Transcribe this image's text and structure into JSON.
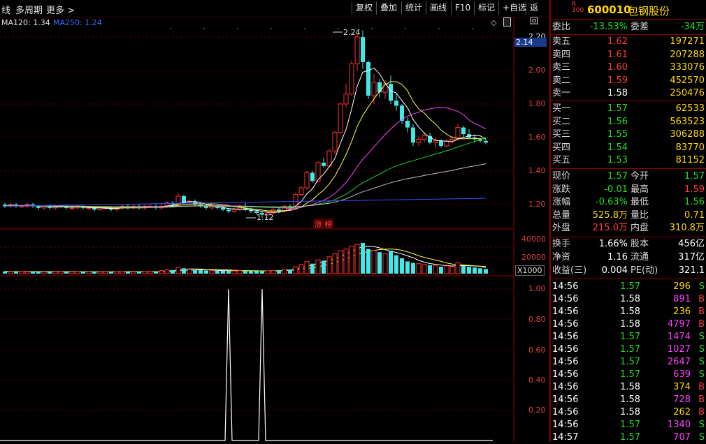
{
  "toolbar": {
    "left_items": [
      "线",
      "多周期",
      "更多 >"
    ],
    "buttons": [
      "复权",
      "叠加",
      "统计",
      "画线",
      "F10",
      "标记",
      "+自选",
      "返回"
    ]
  },
  "chart_header": {
    "ma120": "MA120: 1.34",
    "ma250": "MA250: 1.24"
  },
  "price_axis": {
    "ticks": [
      "2.20",
      "2.00",
      "1.80",
      "1.60",
      "1.40",
      "1.20"
    ],
    "current_label": "2.14",
    "high_annotation": "2.24",
    "low_annotation": "1.12",
    "badge": "涨 榜"
  },
  "volume_axis": {
    "ticks": [
      "40000",
      "20000"
    ],
    "multiplier": "X1000"
  },
  "indicator_axis": {
    "ticks": [
      "1.00",
      "0.80",
      "0.60",
      "0.40",
      "0.20"
    ]
  },
  "stock": {
    "badge_top": "R",
    "badge_bottom": "300",
    "code": "600010",
    "name": "包钢股份"
  },
  "order_book": {
    "ratio_label": "委比",
    "ratio_value": "-13.53%",
    "diff_label": "委差",
    "diff_value": "-34万",
    "asks": [
      {
        "label": "卖五",
        "price": "1.62",
        "volume": "197271"
      },
      {
        "label": "卖四",
        "price": "1.61",
        "volume": "207288"
      },
      {
        "label": "卖三",
        "price": "1.60",
        "volume": "333076"
      },
      {
        "label": "卖二",
        "price": "1.59",
        "volume": "452570"
      },
      {
        "label": "卖一",
        "price": "1.58",
        "volume": "250476"
      }
    ],
    "bids": [
      {
        "label": "买一",
        "price": "1.57",
        "volume": "62533"
      },
      {
        "label": "买二",
        "price": "1.56",
        "volume": "563523"
      },
      {
        "label": "买三",
        "price": "1.55",
        "volume": "306288"
      },
      {
        "label": "买四",
        "price": "1.54",
        "volume": "83770"
      },
      {
        "label": "买五",
        "price": "1.53",
        "volume": "81152"
      }
    ]
  },
  "quote": [
    {
      "l1": "现价",
      "v1": "1.57",
      "c1": "green",
      "l2": "今开",
      "v2": "1.57",
      "c2": "green"
    },
    {
      "l1": "涨跌",
      "v1": "-0.01",
      "c1": "green",
      "l2": "最高",
      "v2": "1.59",
      "c2": "red"
    },
    {
      "l1": "涨幅",
      "v1": "-0.63%",
      "c1": "green",
      "l2": "最低",
      "v2": "1.56",
      "c2": "green"
    },
    {
      "l1": "总量",
      "v1": "525.8万",
      "c1": "yellow",
      "l2": "量比",
      "v2": "0.71",
      "c2": "yellow"
    },
    {
      "l1": "外盘",
      "v1": "215.0万",
      "c1": "red",
      "l2": "内盘",
      "v2": "310.8万",
      "c2": "yellow"
    }
  ],
  "stats": [
    {
      "l1": "换手",
      "v1": "1.66%",
      "l2": "股本",
      "v2": "456亿"
    },
    {
      "l1": "净资",
      "v1": "1.16",
      "l2": "流通",
      "v2": "317亿"
    },
    {
      "l1": "收益(三)",
      "v1": "0.004",
      "l2": "PE(动)",
      "v2": "321.1"
    }
  ],
  "trades": [
    {
      "time": "14:56",
      "price": "1.57",
      "vol": "296",
      "side": "S"
    },
    {
      "time": "14:56",
      "price": "1.58",
      "vol": "891",
      "side": "B"
    },
    {
      "time": "14:56",
      "price": "1.58",
      "vol": "236",
      "side": "B"
    },
    {
      "time": "14:56",
      "price": "1.58",
      "vol": "4797",
      "side": "B"
    },
    {
      "time": "14:56",
      "price": "1.57",
      "vol": "1474",
      "side": "S"
    },
    {
      "time": "14:56",
      "price": "1.57",
      "vol": "1027",
      "side": "S"
    },
    {
      "time": "14:56",
      "price": "1.57",
      "vol": "2647",
      "side": "S"
    },
    {
      "time": "14:56",
      "price": "1.57",
      "vol": "639",
      "side": "S"
    },
    {
      "time": "14:56",
      "price": "1.58",
      "vol": "374",
      "side": "B"
    },
    {
      "time": "14:56",
      "price": "1.58",
      "vol": "728",
      "side": "B"
    },
    {
      "time": "14:56",
      "price": "1.58",
      "vol": "262",
      "side": "B"
    },
    {
      "time": "14:56",
      "price": "1.57",
      "vol": "1340",
      "side": "S"
    },
    {
      "time": "14:57",
      "price": "1.57",
      "vol": "707",
      "side": "S"
    }
  ],
  "chart_data": {
    "type": "bar",
    "candles": [
      [
        1.2,
        1.19,
        1.21,
        1.18
      ],
      [
        1.19,
        1.2,
        1.21,
        1.18
      ],
      [
        1.2,
        1.19,
        1.21,
        1.18
      ],
      [
        1.19,
        1.19,
        1.2,
        1.18
      ],
      [
        1.19,
        1.2,
        1.21,
        1.18
      ],
      [
        1.2,
        1.19,
        1.21,
        1.18
      ],
      [
        1.19,
        1.18,
        1.2,
        1.17
      ],
      [
        1.18,
        1.19,
        1.2,
        1.17
      ],
      [
        1.19,
        1.18,
        1.2,
        1.17
      ],
      [
        1.18,
        1.19,
        1.2,
        1.17
      ],
      [
        1.19,
        1.19,
        1.2,
        1.18
      ],
      [
        1.19,
        1.18,
        1.2,
        1.17
      ],
      [
        1.18,
        1.18,
        1.19,
        1.17
      ],
      [
        1.18,
        1.19,
        1.2,
        1.17
      ],
      [
        1.19,
        1.18,
        1.2,
        1.17
      ],
      [
        1.18,
        1.18,
        1.19,
        1.17
      ],
      [
        1.18,
        1.17,
        1.19,
        1.16
      ],
      [
        1.17,
        1.18,
        1.19,
        1.16
      ],
      [
        1.18,
        1.18,
        1.19,
        1.17
      ],
      [
        1.18,
        1.17,
        1.19,
        1.16
      ],
      [
        1.17,
        1.18,
        1.19,
        1.16
      ],
      [
        1.18,
        1.19,
        1.2,
        1.17
      ],
      [
        1.19,
        1.18,
        1.2,
        1.17
      ],
      [
        1.18,
        1.19,
        1.2,
        1.17
      ],
      [
        1.19,
        1.18,
        1.2,
        1.17
      ],
      [
        1.18,
        1.19,
        1.2,
        1.17
      ],
      [
        1.19,
        1.19,
        1.2,
        1.18
      ],
      [
        1.19,
        1.18,
        1.2,
        1.17
      ],
      [
        1.18,
        1.19,
        1.21,
        1.17
      ],
      [
        1.19,
        1.21,
        1.22,
        1.18
      ],
      [
        1.21,
        1.2,
        1.22,
        1.19
      ],
      [
        1.2,
        1.25,
        1.27,
        1.19
      ],
      [
        1.25,
        1.21,
        1.26,
        1.2
      ],
      [
        1.21,
        1.22,
        1.23,
        1.2
      ],
      [
        1.22,
        1.2,
        1.23,
        1.19
      ],
      [
        1.2,
        1.19,
        1.21,
        1.18
      ],
      [
        1.19,
        1.18,
        1.2,
        1.17
      ],
      [
        1.18,
        1.19,
        1.2,
        1.17
      ],
      [
        1.19,
        1.18,
        1.2,
        1.17
      ],
      [
        1.18,
        1.17,
        1.19,
        1.16
      ],
      [
        1.17,
        1.16,
        1.18,
        1.15
      ],
      [
        1.16,
        1.17,
        1.18,
        1.15
      ],
      [
        1.17,
        1.18,
        1.2,
        1.16
      ],
      [
        1.18,
        1.17,
        1.21,
        1.16
      ],
      [
        1.17,
        1.16,
        1.18,
        1.15
      ],
      [
        1.16,
        1.15,
        1.17,
        1.14
      ],
      [
        1.15,
        1.14,
        1.16,
        1.12
      ],
      [
        1.14,
        1.15,
        1.16,
        1.13
      ],
      [
        1.15,
        1.17,
        1.18,
        1.14
      ],
      [
        1.17,
        1.16,
        1.18,
        1.15
      ],
      [
        1.16,
        1.19,
        1.2,
        1.15
      ],
      [
        1.19,
        1.18,
        1.2,
        1.17
      ],
      [
        1.18,
        1.26,
        1.27,
        1.18
      ],
      [
        1.26,
        1.3,
        1.31,
        1.25
      ],
      [
        1.3,
        1.39,
        1.4,
        1.29
      ],
      [
        1.39,
        1.34,
        1.4,
        1.33
      ],
      [
        1.34,
        1.45,
        1.46,
        1.33
      ],
      [
        1.45,
        1.43,
        1.48,
        1.42
      ],
      [
        1.43,
        1.52,
        1.53,
        1.42
      ],
      [
        1.52,
        1.63,
        1.64,
        1.5
      ],
      [
        1.63,
        1.8,
        1.81,
        1.62
      ],
      [
        1.8,
        1.86,
        1.92,
        1.78
      ],
      [
        1.86,
        2.04,
        2.06,
        1.85
      ],
      [
        2.04,
        2.2,
        2.22,
        2.0
      ],
      [
        2.2,
        2.05,
        2.24,
        2.01
      ],
      [
        2.05,
        1.85,
        2.06,
        1.83
      ],
      [
        1.85,
        1.93,
        1.98,
        1.8
      ],
      [
        1.93,
        1.87,
        1.95,
        1.84
      ],
      [
        1.87,
        1.92,
        1.94,
        1.83
      ],
      [
        1.92,
        1.82,
        1.97,
        1.8
      ],
      [
        1.82,
        1.79,
        1.86,
        1.76
      ],
      [
        1.79,
        1.7,
        1.8,
        1.68
      ],
      [
        1.7,
        1.66,
        1.72,
        1.63
      ],
      [
        1.66,
        1.57,
        1.68,
        1.55
      ],
      [
        1.57,
        1.59,
        1.61,
        1.55
      ],
      [
        1.59,
        1.61,
        1.63,
        1.57
      ],
      [
        1.61,
        1.57,
        1.63,
        1.56
      ],
      [
        1.57,
        1.58,
        1.6,
        1.54
      ],
      [
        1.58,
        1.55,
        1.59,
        1.54
      ],
      [
        1.55,
        1.58,
        1.59,
        1.54
      ],
      [
        1.58,
        1.59,
        1.61,
        1.57
      ],
      [
        1.59,
        1.66,
        1.68,
        1.58
      ],
      [
        1.66,
        1.62,
        1.67,
        1.6
      ],
      [
        1.62,
        1.6,
        1.65,
        1.59
      ],
      [
        1.6,
        1.59,
        1.62,
        1.57
      ],
      [
        1.59,
        1.58,
        1.6,
        1.57
      ],
      [
        1.58,
        1.57,
        1.59,
        1.56
      ]
    ],
    "volumes": [
      3000,
      2500,
      2800,
      2600,
      2400,
      2700,
      2500,
      2300,
      2600,
      2400,
      2500,
      2300,
      2200,
      2400,
      2600,
      2300,
      2500,
      2200,
      2300,
      2400,
      2600,
      2500,
      2400,
      2300,
      2500,
      2700,
      2600,
      2500,
      4000,
      5000,
      4800,
      8000,
      7000,
      5500,
      5000,
      4500,
      4200,
      4000,
      3800,
      3700,
      3500,
      3600,
      4000,
      3800,
      3500,
      3300,
      3600,
      3800,
      4200,
      4500,
      6000,
      5500,
      9000,
      12000,
      16000,
      13000,
      18000,
      17000,
      22000,
      26000,
      30000,
      32000,
      36000,
      38000,
      40000,
      32000,
      30000,
      28000,
      26000,
      30000,
      24000,
      20000,
      16000,
      14000,
      13000,
      12000,
      11000,
      11000,
      9000,
      10000,
      9000,
      14000,
      10000,
      9000,
      8000,
      7000,
      6000
    ],
    "indicator": [
      0,
      0,
      0,
      0,
      0,
      0,
      0,
      0,
      0,
      0,
      0,
      0,
      0,
      0,
      0,
      0,
      0,
      0,
      0,
      0,
      0,
      0,
      0,
      0,
      0,
      0,
      0,
      0,
      0,
      0,
      0,
      0,
      0,
      0,
      0,
      0,
      0,
      0,
      0,
      0,
      0,
      0,
      0,
      0,
      0,
      1,
      0,
      0,
      0,
      0,
      0,
      0,
      0,
      0,
      0,
      0,
      0,
      0,
      0,
      0,
      0,
      0,
      0,
      0,
      0,
      0,
      0,
      0,
      0,
      0,
      0,
      0,
      0,
      0,
      0,
      0,
      0,
      0,
      0,
      0,
      0,
      0,
      0,
      0,
      0,
      0,
      0
    ],
    "ma120": 1.34,
    "ma250": 1.24,
    "ylim": [
      1.1,
      2.3
    ]
  }
}
